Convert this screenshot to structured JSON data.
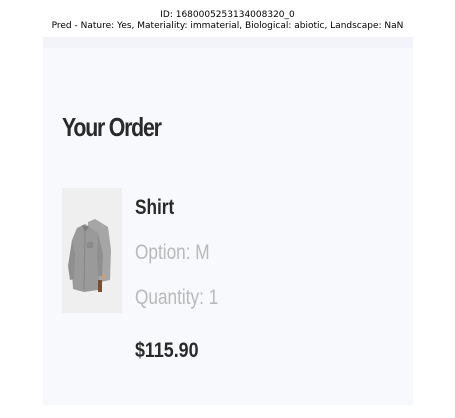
{
  "header": {
    "id_line": "ID: 1680005253134008320_0",
    "pred_line": "Pred - Nature: Yes, Materiality: immaterial, Biological: abiotic, Landscape: NaN"
  },
  "order": {
    "title": "Your Order",
    "item": {
      "name": "Shirt",
      "option": "Option: M",
      "quantity": "Quantity: 1",
      "price": "$115.90",
      "thumbnail_icon": "shirt-icon"
    }
  }
}
